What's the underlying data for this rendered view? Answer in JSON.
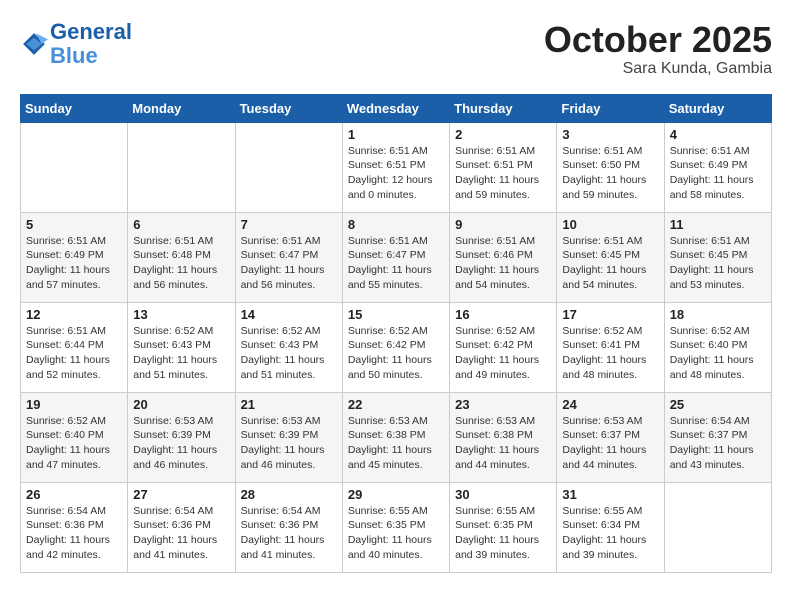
{
  "header": {
    "logo_line1": "General",
    "logo_line2": "Blue",
    "month": "October 2025",
    "location": "Sara Kunda, Gambia"
  },
  "weekdays": [
    "Sunday",
    "Monday",
    "Tuesday",
    "Wednesday",
    "Thursday",
    "Friday",
    "Saturday"
  ],
  "weeks": [
    [
      {
        "day": "",
        "info": ""
      },
      {
        "day": "",
        "info": ""
      },
      {
        "day": "",
        "info": ""
      },
      {
        "day": "1",
        "info": "Sunrise: 6:51 AM\nSunset: 6:51 PM\nDaylight: 12 hours\nand 0 minutes."
      },
      {
        "day": "2",
        "info": "Sunrise: 6:51 AM\nSunset: 6:51 PM\nDaylight: 11 hours\nand 59 minutes."
      },
      {
        "day": "3",
        "info": "Sunrise: 6:51 AM\nSunset: 6:50 PM\nDaylight: 11 hours\nand 59 minutes."
      },
      {
        "day": "4",
        "info": "Sunrise: 6:51 AM\nSunset: 6:49 PM\nDaylight: 11 hours\nand 58 minutes."
      }
    ],
    [
      {
        "day": "5",
        "info": "Sunrise: 6:51 AM\nSunset: 6:49 PM\nDaylight: 11 hours\nand 57 minutes."
      },
      {
        "day": "6",
        "info": "Sunrise: 6:51 AM\nSunset: 6:48 PM\nDaylight: 11 hours\nand 56 minutes."
      },
      {
        "day": "7",
        "info": "Sunrise: 6:51 AM\nSunset: 6:47 PM\nDaylight: 11 hours\nand 56 minutes."
      },
      {
        "day": "8",
        "info": "Sunrise: 6:51 AM\nSunset: 6:47 PM\nDaylight: 11 hours\nand 55 minutes."
      },
      {
        "day": "9",
        "info": "Sunrise: 6:51 AM\nSunset: 6:46 PM\nDaylight: 11 hours\nand 54 minutes."
      },
      {
        "day": "10",
        "info": "Sunrise: 6:51 AM\nSunset: 6:45 PM\nDaylight: 11 hours\nand 54 minutes."
      },
      {
        "day": "11",
        "info": "Sunrise: 6:51 AM\nSunset: 6:45 PM\nDaylight: 11 hours\nand 53 minutes."
      }
    ],
    [
      {
        "day": "12",
        "info": "Sunrise: 6:51 AM\nSunset: 6:44 PM\nDaylight: 11 hours\nand 52 minutes."
      },
      {
        "day": "13",
        "info": "Sunrise: 6:52 AM\nSunset: 6:43 PM\nDaylight: 11 hours\nand 51 minutes."
      },
      {
        "day": "14",
        "info": "Sunrise: 6:52 AM\nSunset: 6:43 PM\nDaylight: 11 hours\nand 51 minutes."
      },
      {
        "day": "15",
        "info": "Sunrise: 6:52 AM\nSunset: 6:42 PM\nDaylight: 11 hours\nand 50 minutes."
      },
      {
        "day": "16",
        "info": "Sunrise: 6:52 AM\nSunset: 6:42 PM\nDaylight: 11 hours\nand 49 minutes."
      },
      {
        "day": "17",
        "info": "Sunrise: 6:52 AM\nSunset: 6:41 PM\nDaylight: 11 hours\nand 48 minutes."
      },
      {
        "day": "18",
        "info": "Sunrise: 6:52 AM\nSunset: 6:40 PM\nDaylight: 11 hours\nand 48 minutes."
      }
    ],
    [
      {
        "day": "19",
        "info": "Sunrise: 6:52 AM\nSunset: 6:40 PM\nDaylight: 11 hours\nand 47 minutes."
      },
      {
        "day": "20",
        "info": "Sunrise: 6:53 AM\nSunset: 6:39 PM\nDaylight: 11 hours\nand 46 minutes."
      },
      {
        "day": "21",
        "info": "Sunrise: 6:53 AM\nSunset: 6:39 PM\nDaylight: 11 hours\nand 46 minutes."
      },
      {
        "day": "22",
        "info": "Sunrise: 6:53 AM\nSunset: 6:38 PM\nDaylight: 11 hours\nand 45 minutes."
      },
      {
        "day": "23",
        "info": "Sunrise: 6:53 AM\nSunset: 6:38 PM\nDaylight: 11 hours\nand 44 minutes."
      },
      {
        "day": "24",
        "info": "Sunrise: 6:53 AM\nSunset: 6:37 PM\nDaylight: 11 hours\nand 44 minutes."
      },
      {
        "day": "25",
        "info": "Sunrise: 6:54 AM\nSunset: 6:37 PM\nDaylight: 11 hours\nand 43 minutes."
      }
    ],
    [
      {
        "day": "26",
        "info": "Sunrise: 6:54 AM\nSunset: 6:36 PM\nDaylight: 11 hours\nand 42 minutes."
      },
      {
        "day": "27",
        "info": "Sunrise: 6:54 AM\nSunset: 6:36 PM\nDaylight: 11 hours\nand 41 minutes."
      },
      {
        "day": "28",
        "info": "Sunrise: 6:54 AM\nSunset: 6:36 PM\nDaylight: 11 hours\nand 41 minutes."
      },
      {
        "day": "29",
        "info": "Sunrise: 6:55 AM\nSunset: 6:35 PM\nDaylight: 11 hours\nand 40 minutes."
      },
      {
        "day": "30",
        "info": "Sunrise: 6:55 AM\nSunset: 6:35 PM\nDaylight: 11 hours\nand 39 minutes."
      },
      {
        "day": "31",
        "info": "Sunrise: 6:55 AM\nSunset: 6:34 PM\nDaylight: 11 hours\nand 39 minutes."
      },
      {
        "day": "",
        "info": ""
      }
    ]
  ]
}
